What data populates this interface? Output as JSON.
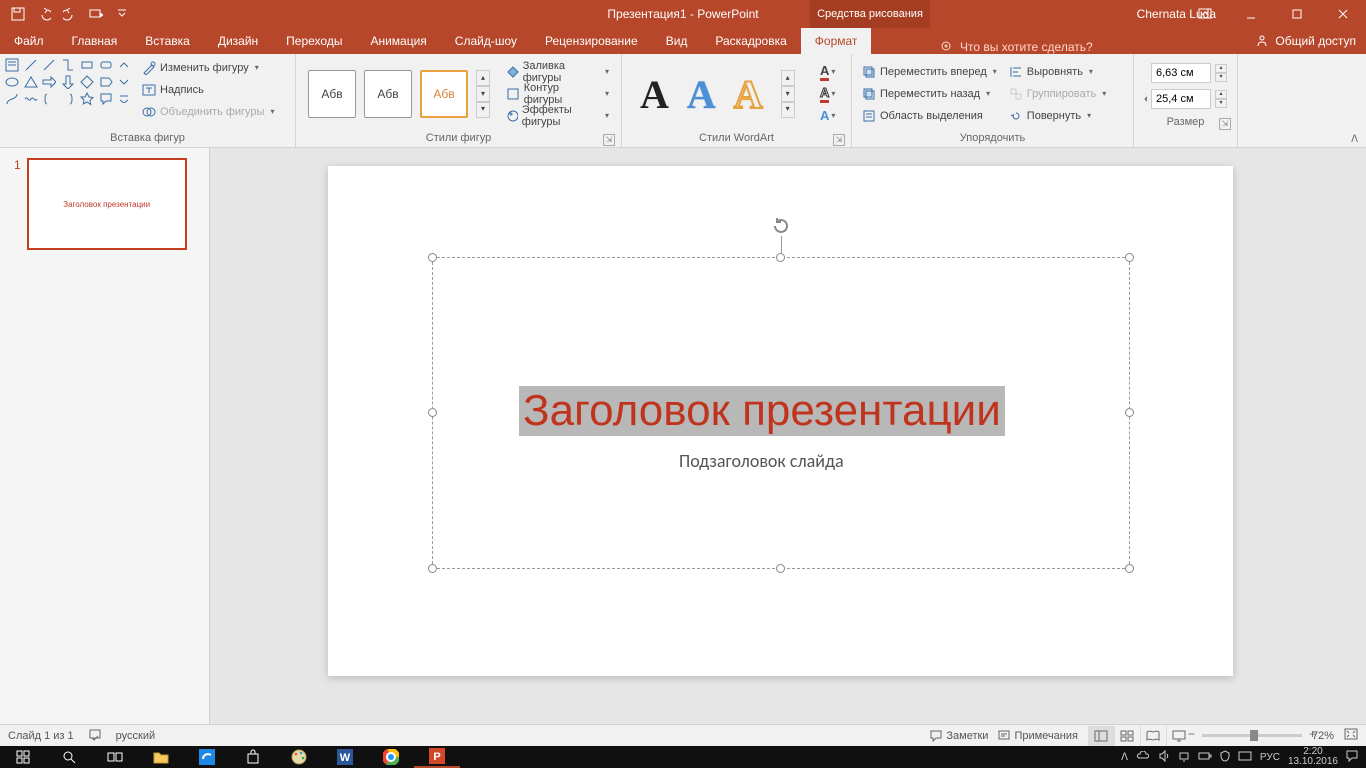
{
  "titlebar": {
    "title": "Презентация1 - PowerPoint",
    "contextual_tab": "Средства рисования",
    "user": "Chernata Luda"
  },
  "tabs": {
    "file": "Файл",
    "home": "Главная",
    "insert": "Вставка",
    "design": "Дизайн",
    "transitions": "Переходы",
    "animations": "Анимация",
    "slideshow": "Слайд-шоу",
    "review": "Рецензирование",
    "view": "Вид",
    "storyboard": "Раскадровка",
    "format": "Формат",
    "tellme": "Что вы хотите сделать?",
    "share": "Общий доступ"
  },
  "ribbon": {
    "insert_shapes": {
      "label": "Вставка фигур",
      "edit_shape": "Изменить фигуру",
      "text_box": "Надпись",
      "merge_shapes": "Объединить фигуры"
    },
    "shape_styles": {
      "label": "Стили фигур",
      "sample": "Абв",
      "fill": "Заливка фигуры",
      "outline": "Контур фигуры",
      "effects": "Эффекты фигуры"
    },
    "wordart_styles": {
      "label": "Стили WordArt"
    },
    "arrange": {
      "label": "Упорядочить",
      "bring_forward": "Переместить вперед",
      "send_backward": "Переместить назад",
      "selection_pane": "Область выделения",
      "align": "Выровнять",
      "group": "Группировать",
      "rotate": "Повернуть"
    },
    "size": {
      "label": "Размер",
      "height": "6,63 см",
      "width": "25,4 см"
    }
  },
  "slides": {
    "thumb_title": "Заголовок презентации",
    "title": "Заголовок презентации",
    "subtitle": "Подзаголовок слайда",
    "current_number": "1"
  },
  "status": {
    "slide_count": "Слайд 1 из 1",
    "language": "русский",
    "notes": "Заметки",
    "comments": "Примечания",
    "zoom": "72%"
  },
  "taskbar": {
    "lang": "РУС",
    "time": "2:20",
    "date": "13.10.2016"
  }
}
